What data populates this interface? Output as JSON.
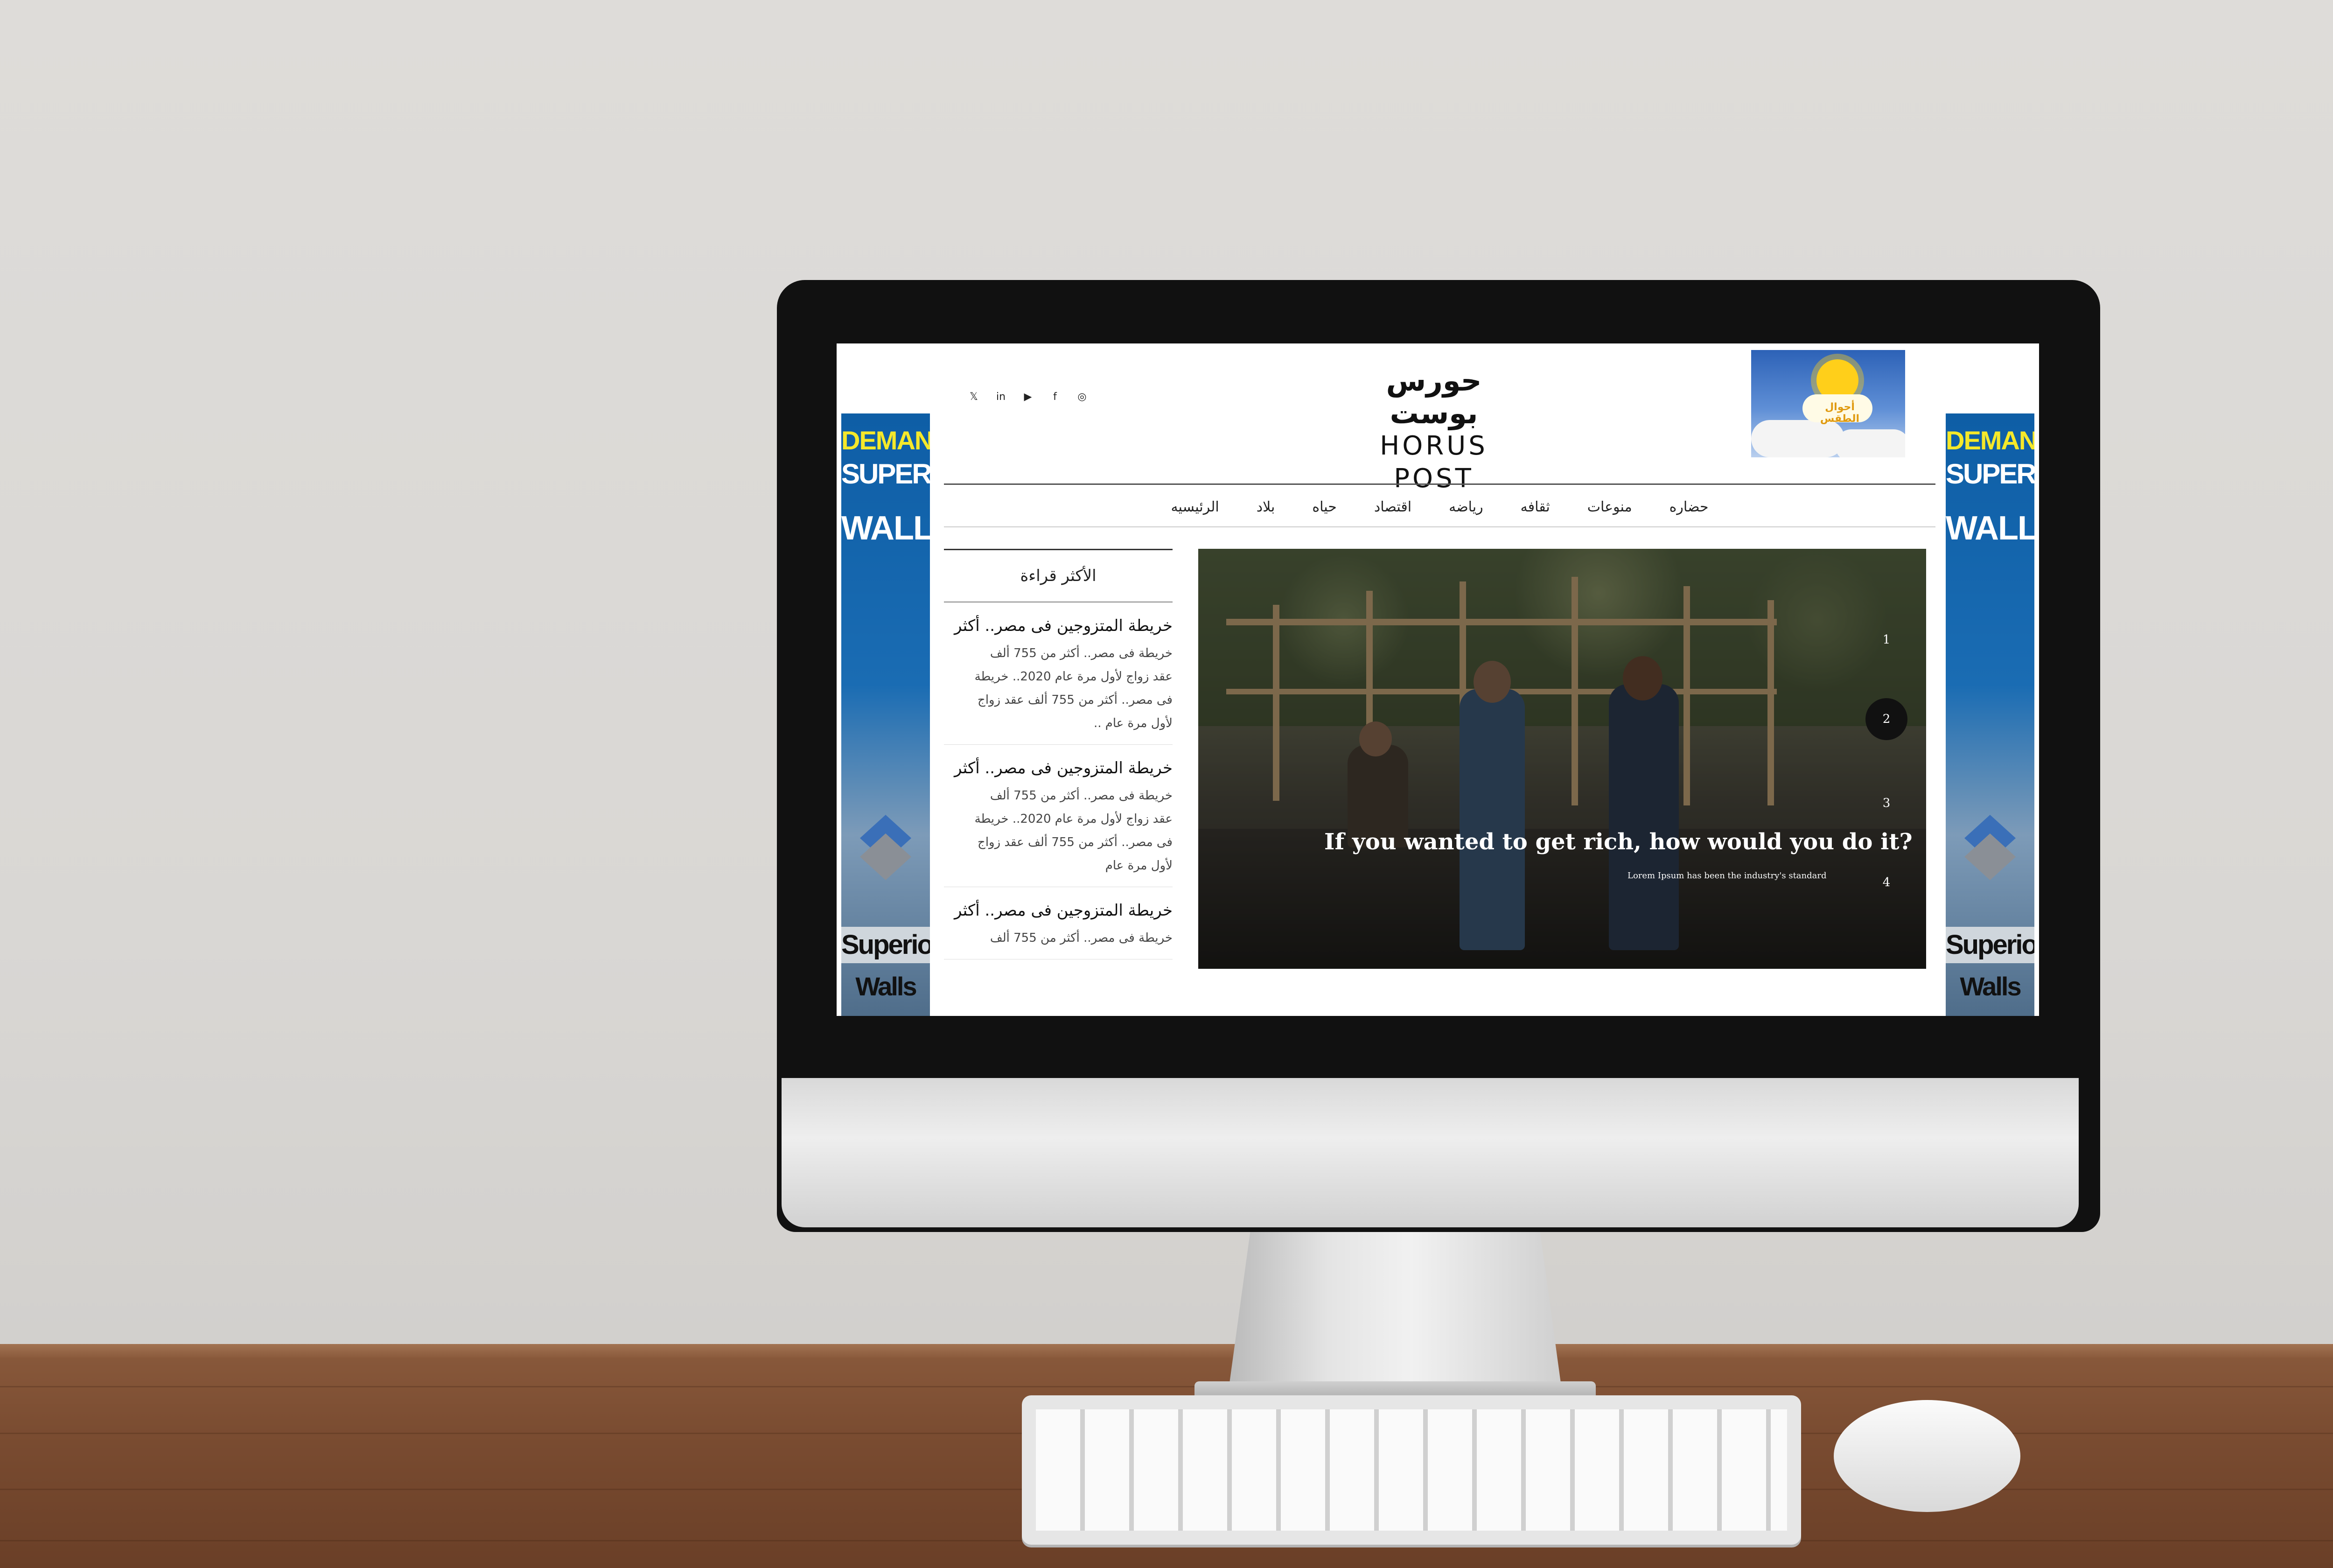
{
  "site": {
    "logo_ar": "حورس بوست",
    "logo_en": "HORUS POST",
    "weather_label": "أحوال الطقس"
  },
  "social": [
    "twitter-icon",
    "linkedin-icon",
    "youtube-icon",
    "facebook-icon",
    "instagram-icon"
  ],
  "social_glyphs": [
    "𝕏",
    "in",
    "▶",
    "f",
    "◎"
  ],
  "nav": [
    "الرئيسيه",
    "بلاد",
    "حياه",
    "اقتصاد",
    "رياضه",
    "ثقافه",
    "منوعات",
    "حضاره"
  ],
  "slider": {
    "title": "If you wanted to get rich, how would you do it?",
    "subtitle": "Lorem Ipsum has been the industry's standard",
    "dots": [
      "1",
      "2",
      "3",
      "4"
    ],
    "active_dot": "2"
  },
  "sidebar": {
    "title": "الأكثر قراءة",
    "items": [
      {
        "heading": "خريطة المتزوجين فى مصر.. أكثر",
        "body": "خريطة فى مصر.. أكثر من 755 ألف عقد زواج لأول مرة عام 2020.. خريطة فى مصر.. أكثر من 755 ألف عقد زواج لأول مرة عام .."
      },
      {
        "heading": "خريطة المتزوجين فى مصر.. أكثر",
        "body": "خريطة فى مصر.. أكثر من 755 ألف عقد زواج لأول مرة عام 2020.. خريطة فى مصر.. أكثر من 755 ألف عقد زواج لأول مرة عام"
      },
      {
        "heading": "خريطة المتزوجين فى مصر.. أكثر",
        "body": "خريطة فى مصر.. أكثر من 755 ألف"
      }
    ]
  },
  "ads": {
    "line1": "DEMAND",
    "line2": "SUPERIOR",
    "line3": "WALLS",
    "brand1": "Superior",
    "brand2": "Walls"
  }
}
